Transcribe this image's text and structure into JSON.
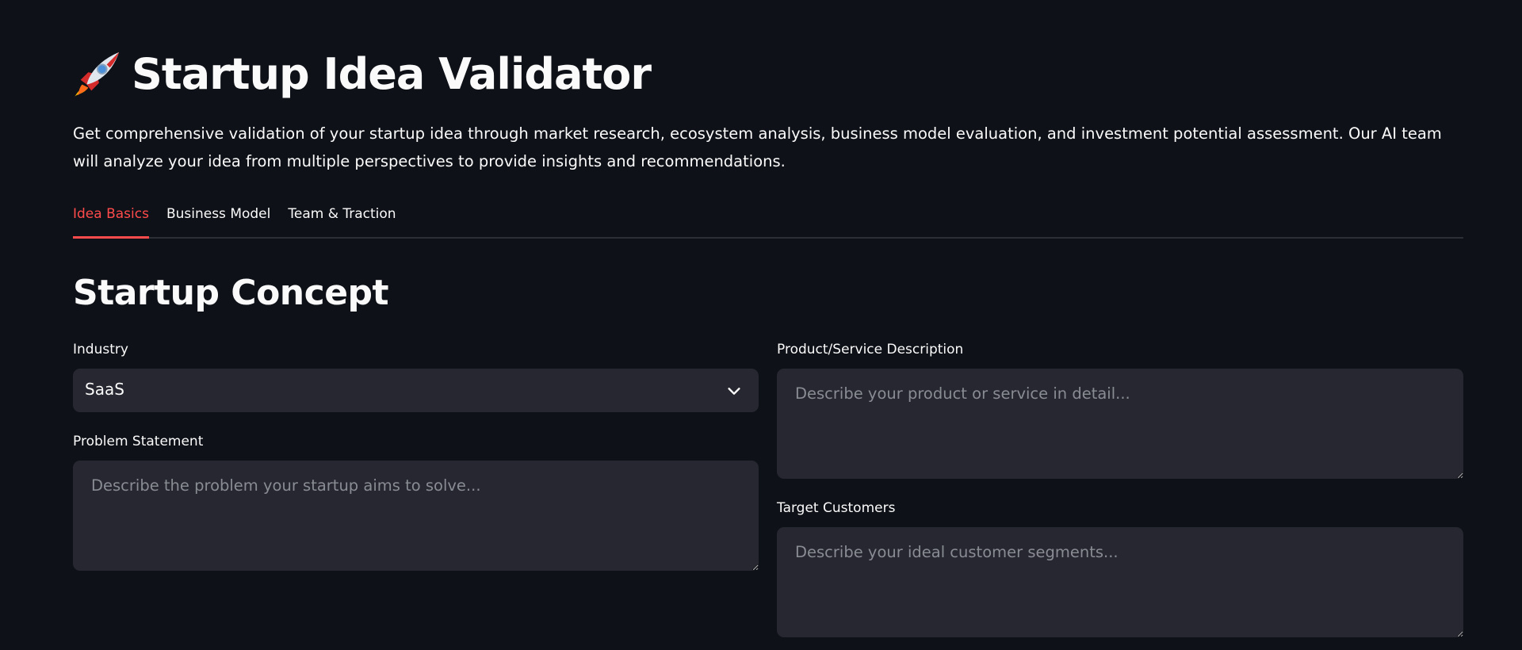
{
  "header": {
    "icon": "rocket-icon",
    "title": "Startup Idea Validator",
    "description": "Get comprehensive validation of your startup idea through market research, ecosystem analysis, business model evaluation, and investment potential assessment. Our AI team will analyze your idea from multiple perspectives to provide insights and recommendations."
  },
  "tabs": [
    {
      "label": "Idea Basics",
      "active": true
    },
    {
      "label": "Business Model",
      "active": false
    },
    {
      "label": "Team & Traction",
      "active": false
    }
  ],
  "section": {
    "title": "Startup Concept"
  },
  "form": {
    "industry": {
      "label": "Industry",
      "value": "SaaS"
    },
    "problem": {
      "label": "Problem Statement",
      "placeholder": "Describe the problem your startup aims to solve..."
    },
    "product": {
      "label": "Product/Service Description",
      "placeholder": "Describe your product or service in detail..."
    },
    "customers": {
      "label": "Target Customers",
      "placeholder": "Describe your ideal customer segments..."
    }
  },
  "colors": {
    "background": "#0e1117",
    "input_background": "#262730",
    "accent": "#ff4b4b",
    "text": "#fafafa",
    "placeholder": "#8a8c94"
  }
}
